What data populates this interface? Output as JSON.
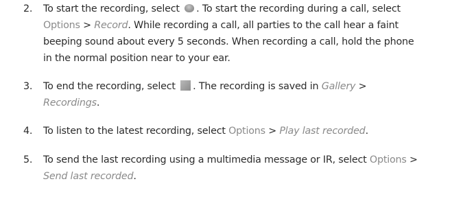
{
  "steps": [
    {
      "number": "2.",
      "lines": [
        {
          "a": "To start the recording, select ",
          "icon": "record-icon",
          "b": ". To start the recording during a call, select"
        },
        {
          "menu": "Options",
          "sep": " > ",
          "em": "Record",
          "rest": ". While recording a call, all parties to the call hear a faint"
        },
        {
          "text": "beeping sound about every 5 seconds. When recording a call, hold the phone"
        },
        {
          "text": "in the normal position near to your ear."
        }
      ]
    },
    {
      "number": "3.",
      "lines": [
        {
          "a": "To end the recording, select ",
          "icon": "stop-icon",
          "b": ". The recording is saved in ",
          "em": "Gallery",
          "sep": " >"
        },
        {
          "em": "Recordings",
          "rest": "."
        }
      ]
    },
    {
      "number": "4.",
      "lines": [
        {
          "a": "To listen to the latest recording, select ",
          "menu": "Options",
          "sep": " > ",
          "em": "Play last recorded",
          "rest": "."
        }
      ]
    },
    {
      "number": "5.",
      "lines": [
        {
          "a": "To send the last recording using a multimedia message or IR, select ",
          "menu": "Options",
          "sep": " >"
        },
        {
          "em": "Send last recorded",
          "rest": "."
        }
      ]
    }
  ]
}
